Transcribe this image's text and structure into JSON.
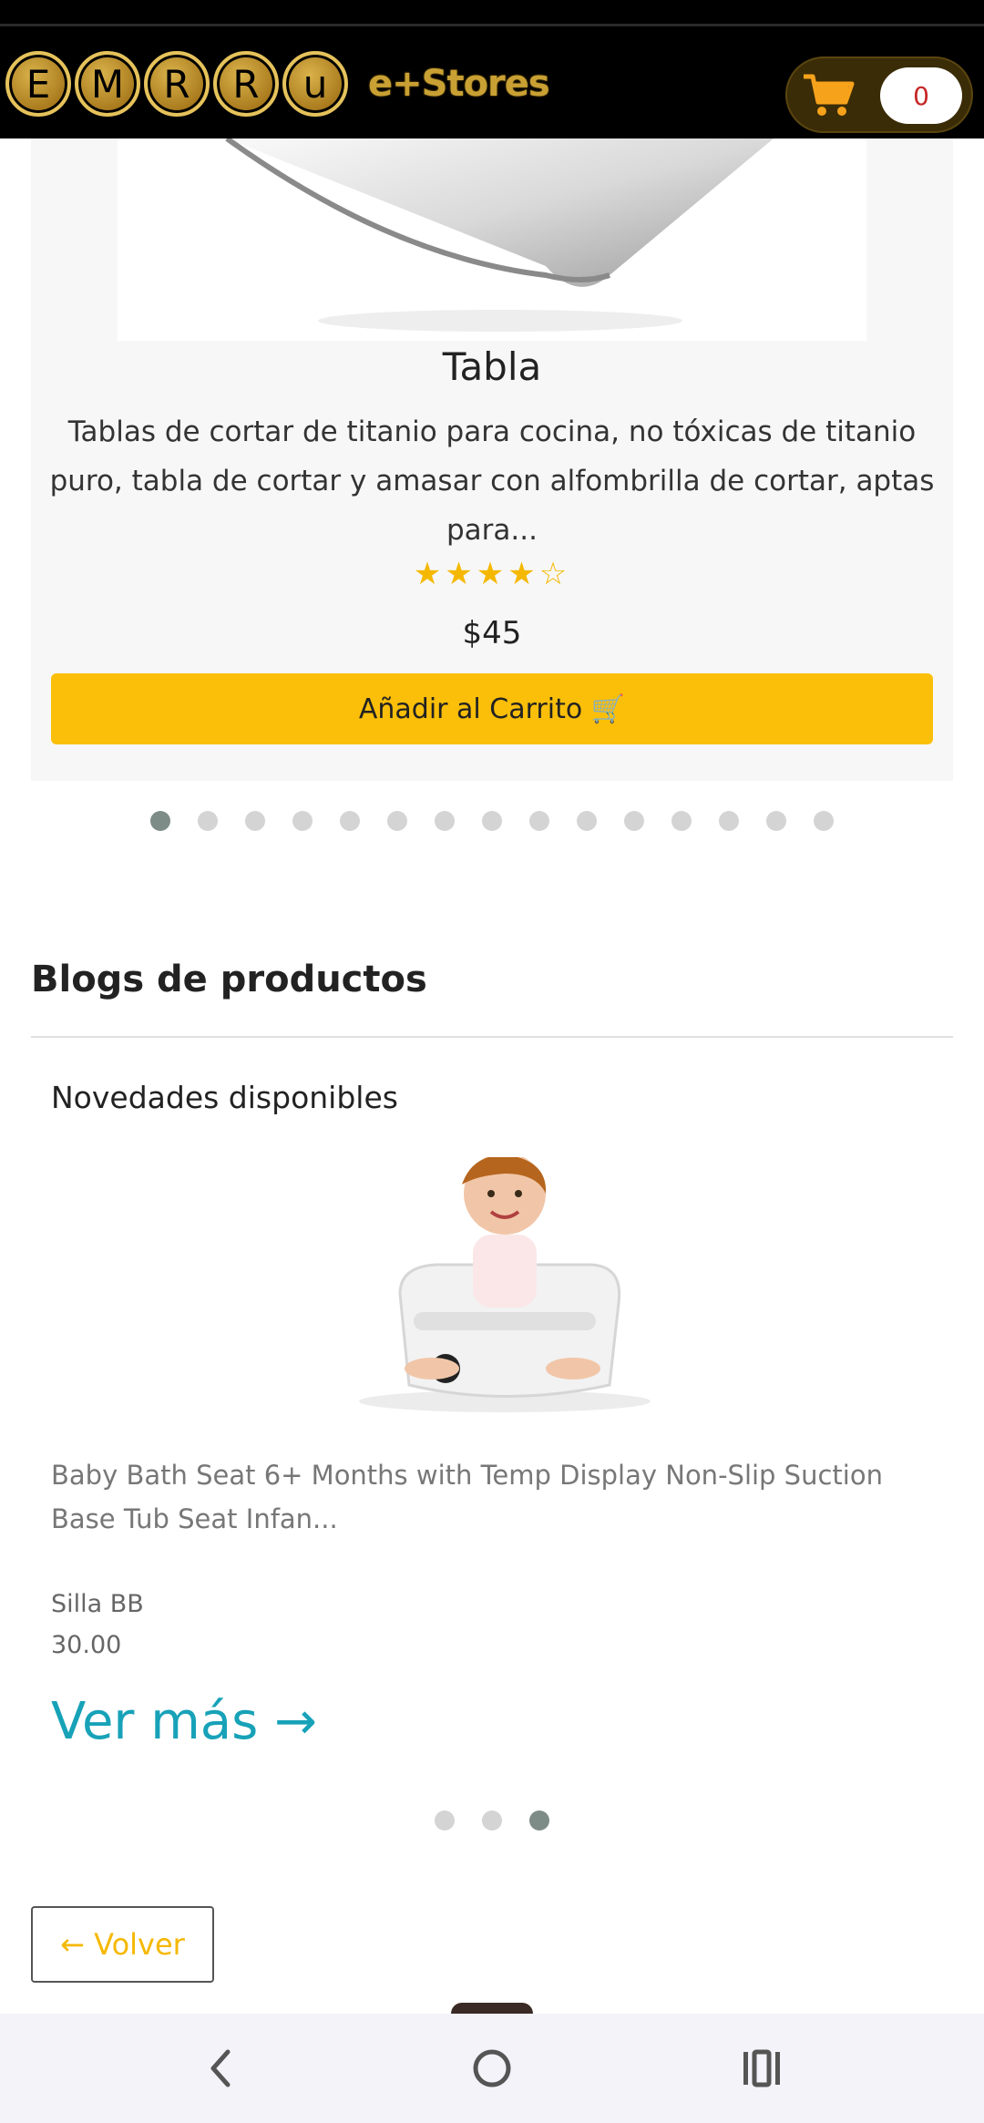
{
  "header": {
    "logo_letters": [
      "E",
      "M",
      "R",
      "R",
      "u"
    ],
    "logo_suffix": "e+Stores",
    "cart_icon": "shopping-cart-icon",
    "cart_count": "0"
  },
  "product": {
    "title": "Tabla",
    "description": "Tablas de cortar de titanio para cocina, no tóxicas de titanio puro, tabla de cortar y amasar con alfombrilla de cortar, aptas para...",
    "rating": 4,
    "rating_max": 5,
    "price": "$45",
    "add_to_cart_label": "Añadir al Carrito 🛒"
  },
  "product_carousel": {
    "total": 15,
    "active_index": 0
  },
  "blogs": {
    "heading": "Blogs de productos",
    "subtitle": "Novedades disponibles",
    "description": "Baby Bath Seat 6+ Months with Temp Display Non-Slip Suction Base Tub Seat Infan...",
    "name": "Silla BB",
    "price": "30.00",
    "more_label": "Ver más →"
  },
  "blog_carousel": {
    "total": 3,
    "active_index": 2
  },
  "back_label": "← Volver",
  "nav": {
    "back_icon": "back-chevron-icon",
    "home_icon": "home-circle-icon",
    "recents_icon": "recent-apps-icon"
  },
  "colors": {
    "accent_yellow": "#fbbf09",
    "link_teal": "#17a2b8",
    "header_bg": "#000000",
    "gold": "#c9a033"
  }
}
